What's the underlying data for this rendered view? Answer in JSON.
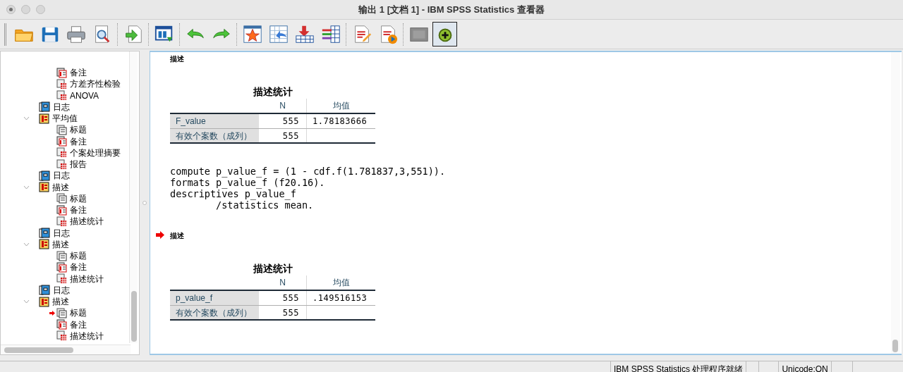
{
  "window": {
    "title": "输出 1 [文档 1] - IBM SPSS Statistics 查看器"
  },
  "outline": {
    "items": [
      {
        "children": [
          {
            "label": "备注",
            "kind": "note",
            "current": false
          },
          {
            "label": "方差齐性检验",
            "kind": "table",
            "current": false
          },
          {
            "label": "ANOVA",
            "kind": "table",
            "current": false
          }
        ]
      },
      {
        "label": "日志",
        "kind": "log",
        "current": false
      },
      {
        "label": "平均值",
        "kind": "group",
        "expanded": true,
        "current": false,
        "children": [
          {
            "label": "标题",
            "kind": "title",
            "current": false
          },
          {
            "label": "备注",
            "kind": "note",
            "current": false
          },
          {
            "label": "个案处理摘要",
            "kind": "table",
            "current": false
          },
          {
            "label": "报告",
            "kind": "table",
            "current": false
          }
        ]
      },
      {
        "label": "日志",
        "kind": "log",
        "current": false
      },
      {
        "label": "描述",
        "kind": "group",
        "expanded": true,
        "current": false,
        "children": [
          {
            "label": "标题",
            "kind": "title",
            "current": false
          },
          {
            "label": "备注",
            "kind": "note",
            "current": false
          },
          {
            "label": "描述统计",
            "kind": "table",
            "current": false
          }
        ]
      },
      {
        "label": "日志",
        "kind": "log",
        "current": false
      },
      {
        "label": "描述",
        "kind": "group",
        "expanded": true,
        "current": false,
        "children": [
          {
            "label": "标题",
            "kind": "title",
            "current": false
          },
          {
            "label": "备注",
            "kind": "note",
            "current": false
          },
          {
            "label": "描述统计",
            "kind": "table",
            "current": false
          }
        ]
      },
      {
        "label": "日志",
        "kind": "log",
        "current": false
      },
      {
        "label": "描述",
        "kind": "group",
        "expanded": true,
        "current": false,
        "children": [
          {
            "label": "标题",
            "kind": "title",
            "current": true
          },
          {
            "label": "备注",
            "kind": "note",
            "current": false
          },
          {
            "label": "描述统计",
            "kind": "table",
            "current": false
          }
        ]
      }
    ]
  },
  "output": {
    "blocks": [
      {
        "kind": "heading",
        "text": "描述",
        "current": false
      },
      {
        "kind": "table",
        "title": "描述统计",
        "columns": [
          "N",
          "均值"
        ],
        "rows": [
          {
            "label": "F_value",
            "cells": [
              "555",
              "1.78183666"
            ]
          },
          {
            "label": "有效个案数（成列）",
            "cells": [
              "555"
            ]
          }
        ]
      },
      {
        "kind": "syntax",
        "lines": [
          "compute p_value_f = (1 - cdf.f(1.781837,3,551)).",
          "formats p_value_f (f20.16).",
          "descriptives p_value_f",
          "        /statistics mean."
        ]
      },
      {
        "kind": "heading",
        "text": "描述",
        "current": true
      },
      {
        "kind": "table",
        "title": "描述统计",
        "columns": [
          "N",
          "均值"
        ],
        "rows": [
          {
            "label": "p_value_f",
            "cells": [
              "555",
              ".149516153"
            ]
          },
          {
            "label": "有效个案数（成列）",
            "cells": [
              "555"
            ]
          }
        ]
      }
    ]
  },
  "status_bar": [
    "IBM SPSS Statistics 处理程序就绪",
    "Unicode:ON"
  ]
}
